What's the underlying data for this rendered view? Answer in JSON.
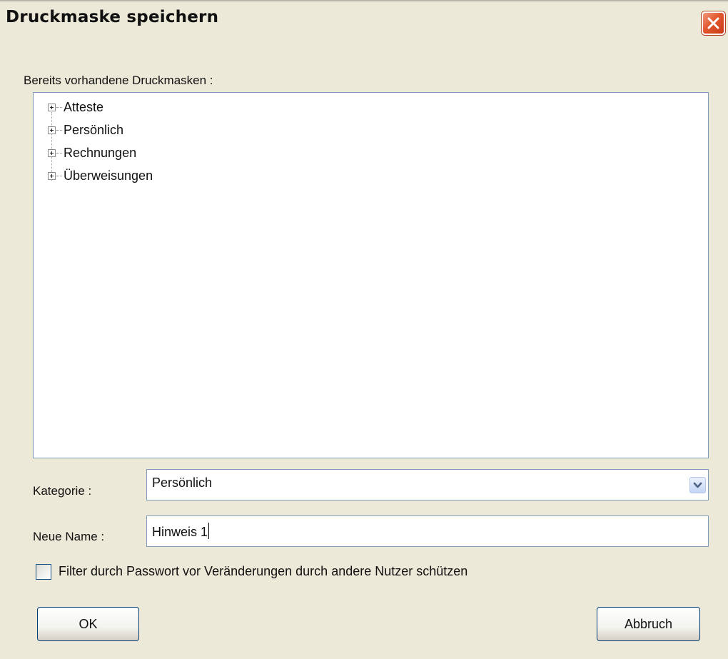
{
  "window": {
    "title": "Druckmaske speichern",
    "close_icon": "close-icon"
  },
  "existing": {
    "label": "Bereits vorhandene Druckmasken :",
    "items": [
      {
        "label": "Atteste"
      },
      {
        "label": "Persönlich"
      },
      {
        "label": "Rechnungen"
      },
      {
        "label": "Überweisungen"
      }
    ]
  },
  "category": {
    "label": "Kategorie :",
    "value": "Persönlich"
  },
  "name": {
    "label": "Neue Name :",
    "value": "Hinweis 1"
  },
  "password_filter": {
    "label": "Filter durch Passwort vor Veränderungen durch andere Nutzer schützen",
    "checked": false
  },
  "buttons": {
    "ok": "OK",
    "cancel": "Abbruch"
  },
  "colors": {
    "background": "#ece9d8",
    "border": "#7f9db9",
    "close": "#e2582f"
  }
}
